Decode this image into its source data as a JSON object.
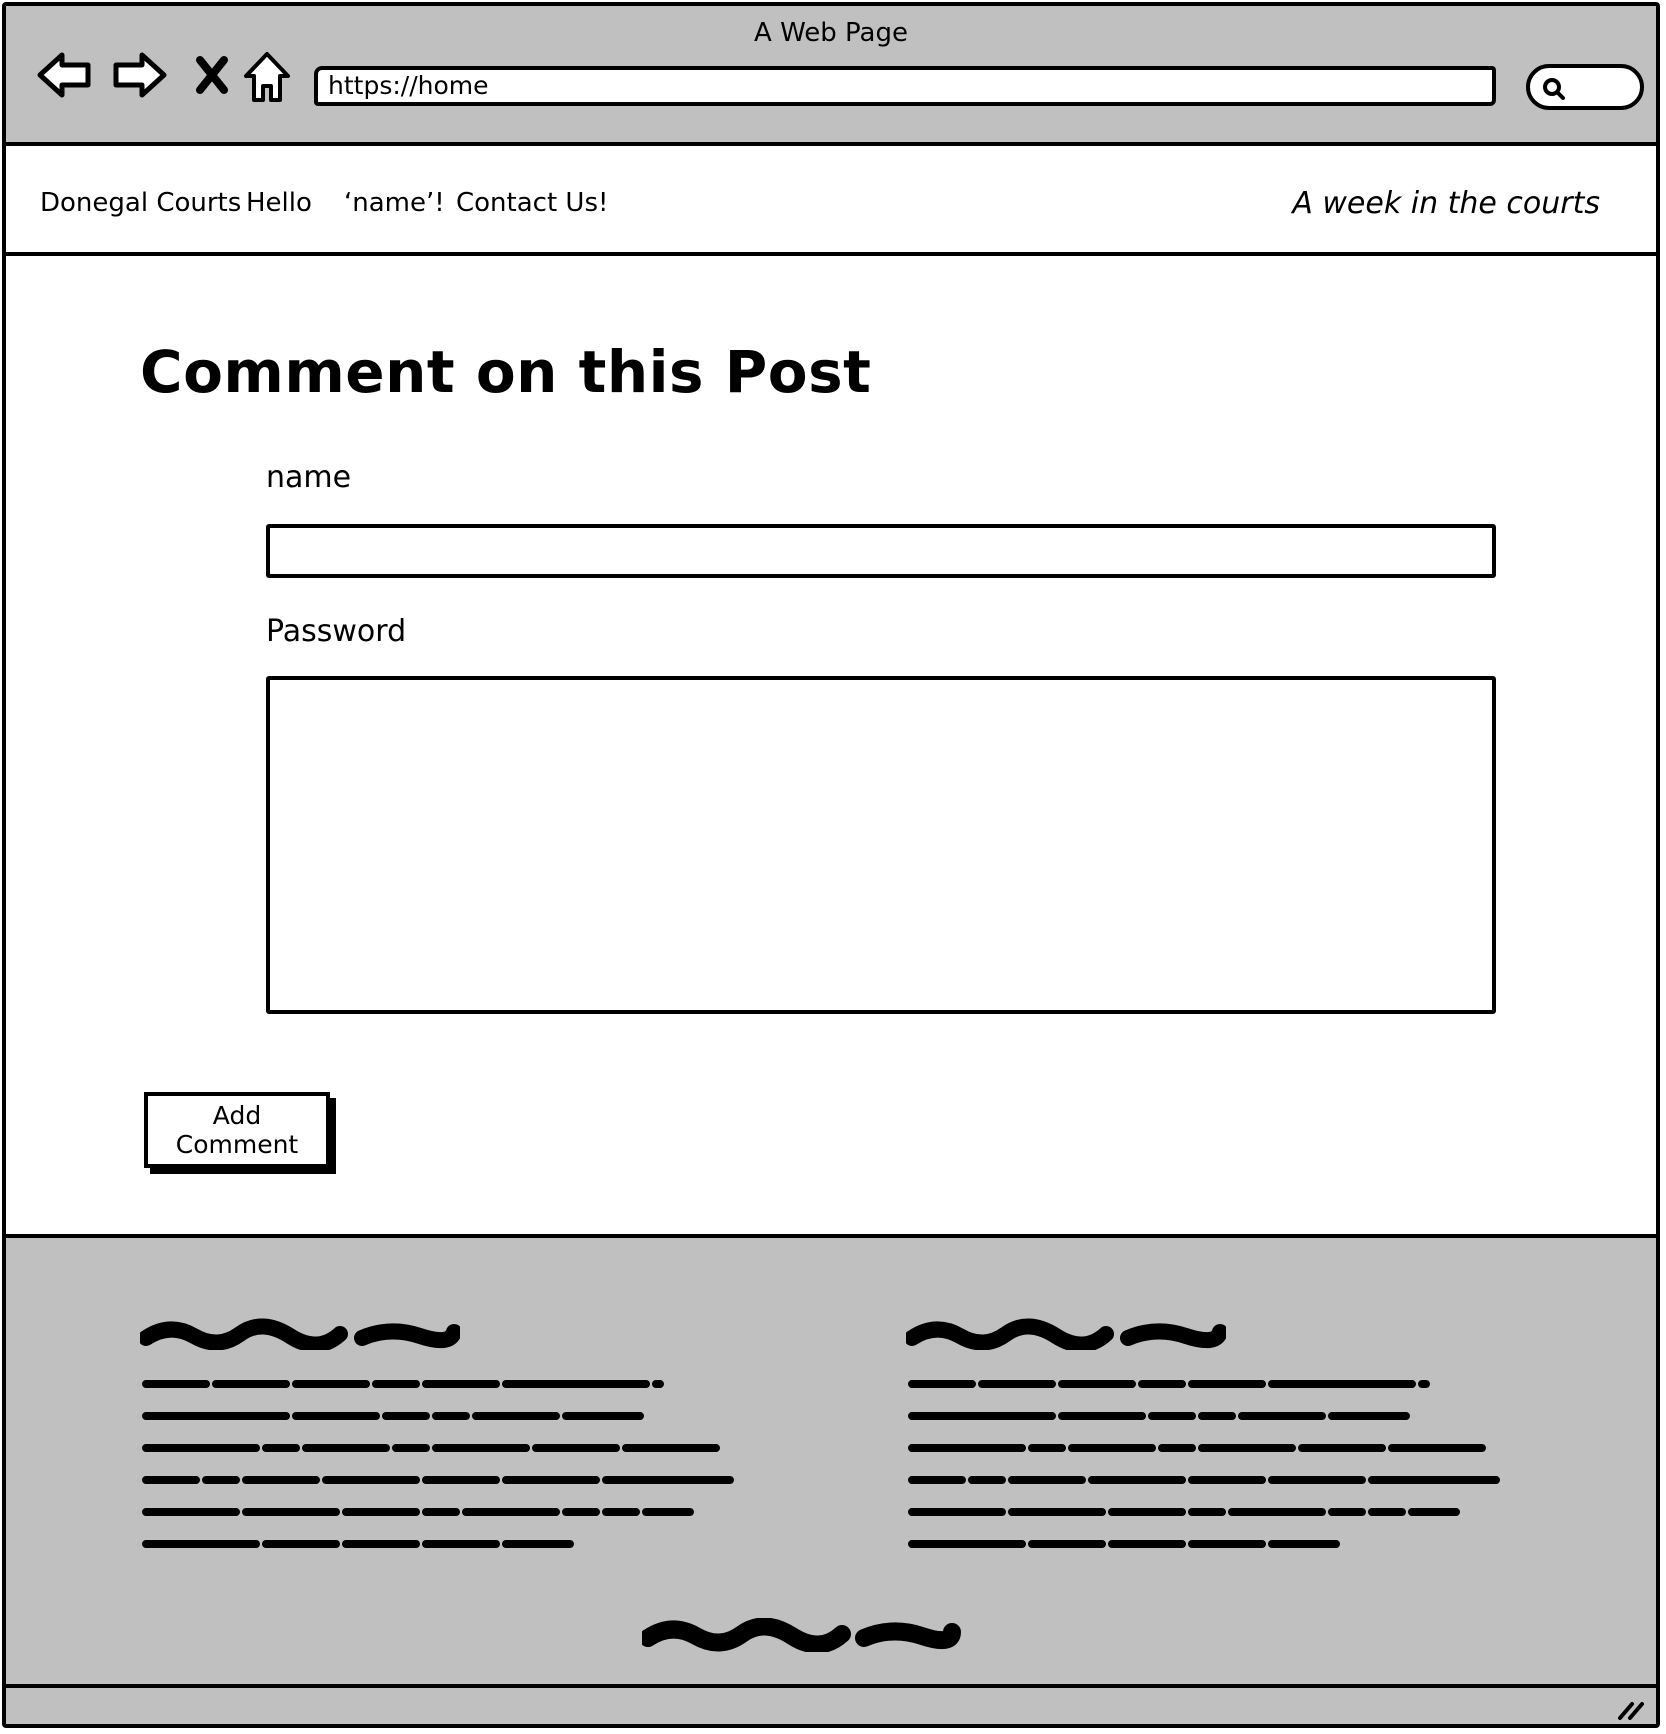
{
  "browser": {
    "window_title": "A Web Page",
    "url": "https://home",
    "nav_icons": [
      "back-arrow-icon",
      "forward-arrow-icon",
      "stop-icon",
      "home-icon"
    ],
    "search_icon": "search-icon"
  },
  "header": {
    "nav_items": [
      "Donegal Courts",
      "Hello",
      "‘name’!",
      "Contact Us!"
    ],
    "tagline": "A week in the courts"
  },
  "main": {
    "title": "Comment on this Post",
    "name_label": "name",
    "name_value": "",
    "password_label": "Password",
    "password_value": "",
    "submit_label": "Add Comment"
  },
  "colors": {
    "chrome_gray": "#c0c0c0",
    "border": "#000000",
    "background": "#ffffff"
  }
}
